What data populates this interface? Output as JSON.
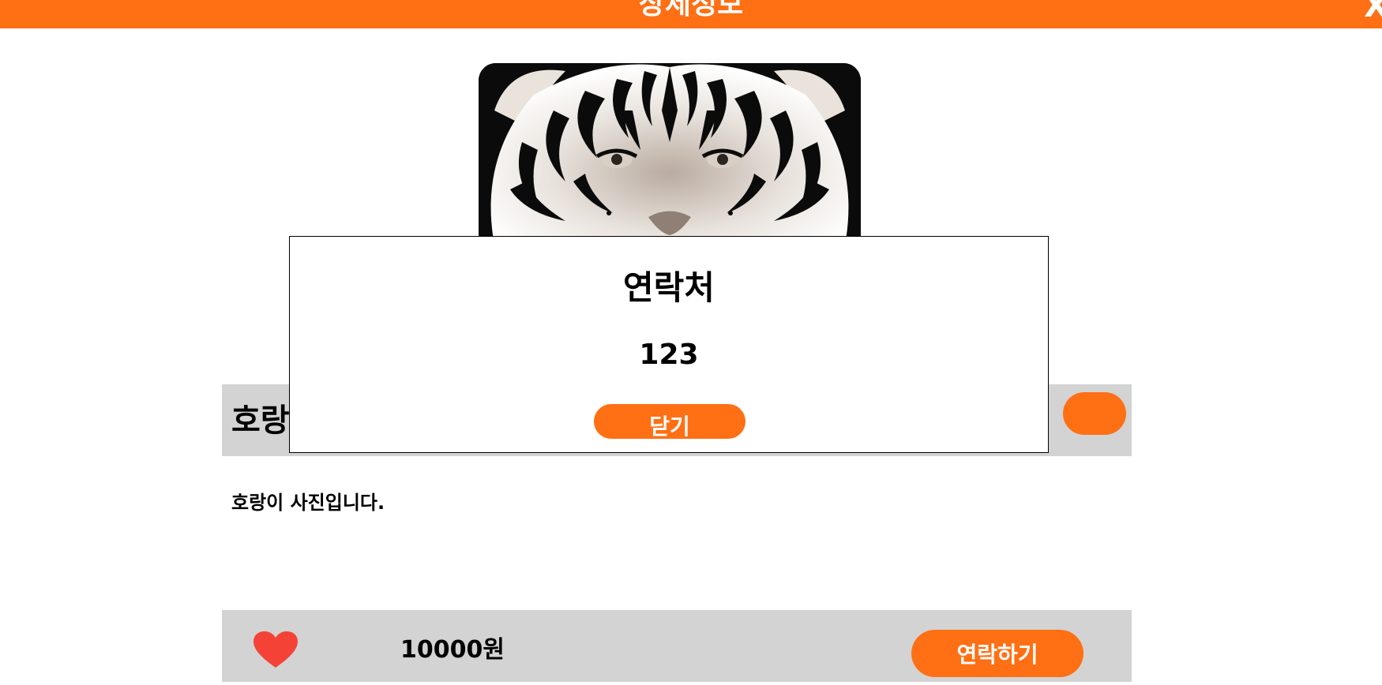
{
  "header": {
    "title": "상세정보",
    "close_label": "X",
    "bg_color": "#ff6f14"
  },
  "item": {
    "image_icon": "tiger-photo",
    "title": "호랑",
    "description": "호랑이 사진입니다."
  },
  "bottom_bar": {
    "heart_icon": "heart-icon",
    "price": "10000원",
    "contact_label": "연락하기"
  },
  "modal": {
    "title": "연락처",
    "value": "123",
    "close_label": "닫기"
  },
  "colors": {
    "accent": "#ff6f14",
    "panel_gray": "#d3d3d3",
    "heart": "#f44336"
  }
}
